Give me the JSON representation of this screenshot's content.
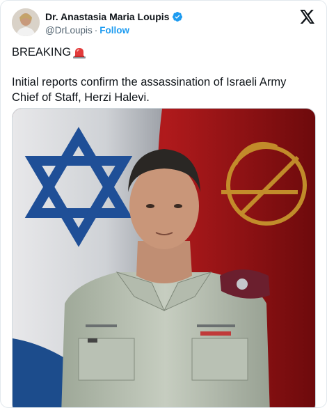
{
  "author": {
    "display_name": "Dr. Anastasia Maria Loupis",
    "handle": "@DrLoupis",
    "separator": "·",
    "follow_label": "Follow",
    "verified_color": "#1d9bf0"
  },
  "post": {
    "line1": "BREAKING",
    "line1_icon": "police-siren-emoji",
    "line2": "Initial reports confirm the assassination of Israeli Army Chief of Staff, Herzi Halevi."
  },
  "media": {
    "type": "photo",
    "subject": "uniformed officer portrait"
  },
  "colors": {
    "accent": "#1d9bf0",
    "text": "#0f1419",
    "secondary": "#536471"
  }
}
